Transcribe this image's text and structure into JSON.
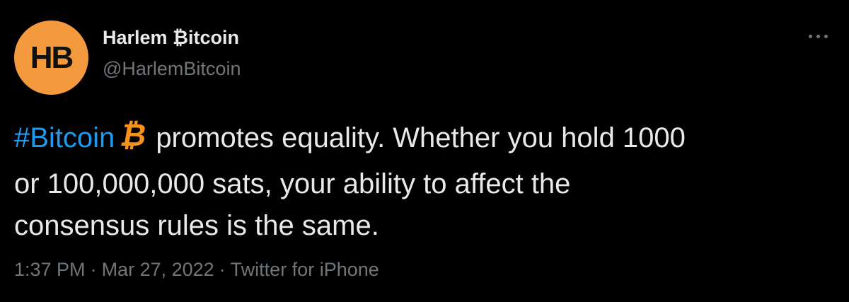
{
  "author": {
    "avatar_text": "HB",
    "display_name": "Harlem ₿itcoin",
    "handle": "@HarlemBitcoin",
    "avatar_color": "#f39a3e"
  },
  "tweet": {
    "hashtag": "#Bitcoin",
    "emoji_icon": "bitcoin-icon",
    "text_line1": "promotes equality. Whether you hold 1000",
    "text_line2": "or 100,000,000 sats, your ability to affect the",
    "text_line3": "consensus rules is the same."
  },
  "meta": {
    "time": "1:37 PM",
    "separator": "·",
    "date": "Mar 27, 2022",
    "source": "Twitter for iPhone"
  },
  "colors": {
    "background": "#000000",
    "text": "#e7e9ea",
    "secondary": "#71767b",
    "link": "#1d9bf0",
    "bitcoin_orange": "#f7931a"
  }
}
